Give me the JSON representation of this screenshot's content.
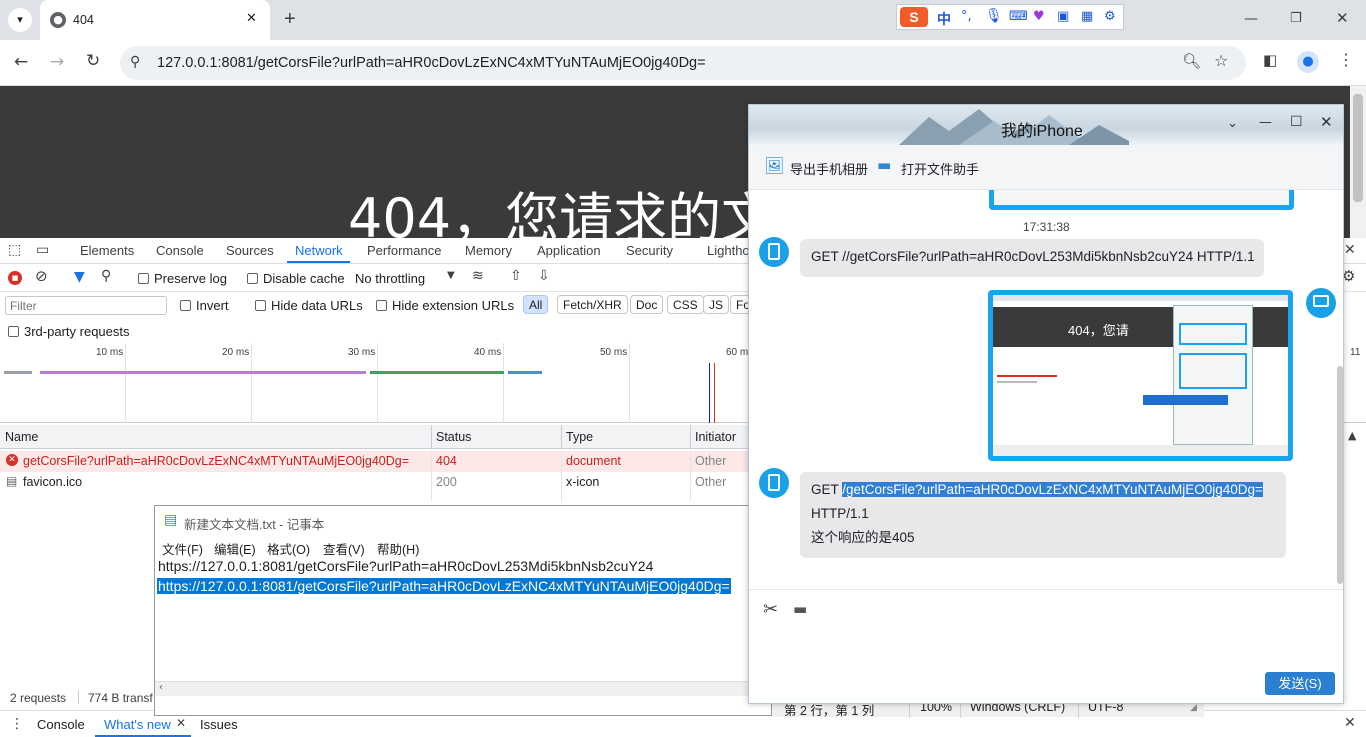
{
  "browser": {
    "tab_title": "404",
    "new_tab": "+",
    "url": "127.0.0.1:8081/getCorsFile?urlPath=aHR0cDovLzExNC4xMTYuNTAuMjEO0jg40Dg="
  },
  "ime": {
    "brand": "S",
    "mode": "中"
  },
  "page": {
    "title": "404，您请求的文"
  },
  "devtools": {
    "tabs": [
      "Elements",
      "Console",
      "Sources",
      "Network",
      "Performance",
      "Memory",
      "Application",
      "Security",
      "Lightho"
    ],
    "active_tab": "Network",
    "preserve_log": "Preserve log",
    "disable_cache": "Disable cache",
    "throttling": "No throttling",
    "filter_placeholder": "Filter",
    "invert": "Invert",
    "hide_data_urls": "Hide data URLs",
    "hide_ext_urls": "Hide extension URLs",
    "type_filters": [
      "All",
      "Fetch/XHR",
      "Doc",
      "CSS",
      "JS",
      "Fo"
    ],
    "third_party": "3rd-party requests",
    "ticks": [
      "10 ms",
      "20 ms",
      "30 ms",
      "40 ms",
      "50 ms",
      "60 ms"
    ],
    "tick_right": "11",
    "columns": {
      "name": "Name",
      "status": "Status",
      "type": "Type",
      "initiator": "Initiator"
    },
    "rows": [
      {
        "name": "getCorsFile?urlPath=aHR0cDovLzExNC4xMTYuNTAuMjEO0jg40Dg=",
        "status": "404",
        "type": "document",
        "initiator": "Other"
      },
      {
        "name": "favicon.ico",
        "status": "200",
        "type": "x-icon",
        "initiator": "Other"
      }
    ],
    "requests": "2 requests",
    "transfer": "774 B transf",
    "drawer_tabs": {
      "console": "Console",
      "whats_new": "What's new",
      "issues": "Issues"
    }
  },
  "notepad": {
    "title": "新建文本文档.txt - 记事本",
    "menu": [
      "文件(F)",
      "编辑(E)",
      "格式(O)",
      "查看(V)",
      "帮助(H)"
    ],
    "line1": "https://127.0.0.1:8081/getCorsFile?urlPath=aHR0cDovL253Mdi5kbnNsb2cuY24",
    "line2": "https://127.0.0.1:8081/getCorsFile?urlPath=aHR0cDovLzExNC4xMTYuNTAuMjEO0jg40Dg=",
    "status": {
      "position": "第 2 行，第 1 列",
      "zoom": "100%",
      "eol": "Windows (CRLF)",
      "encoding": "UTF-8"
    }
  },
  "qq": {
    "title": "我的iPhone",
    "export_album": "导出手机相册",
    "open_file_helper": "打开文件助手",
    "timestamp": "17:31:38",
    "msg1": "GET //getCorsFile?urlPath=aHR0cDovL253Mdi5kbnNsb2cuY24 HTTP/1.1",
    "thumb_text": "404，您请",
    "msg3_prefix": "GET ",
    "msg3_highlight": "/getCorsFile?urlPath=aHR0cDovLzExNC4xMTYuNTAuMjEO0jg40Dg=",
    "msg3_line2": "HTTP/1.1",
    "msg3_line3": "这个响应的是405",
    "send": "发送(S)"
  },
  "colors": {
    "accent": "#1a73e8",
    "error": "#c5221f",
    "qq_blue": "#1aa0e6",
    "selection": "#0078d7"
  }
}
